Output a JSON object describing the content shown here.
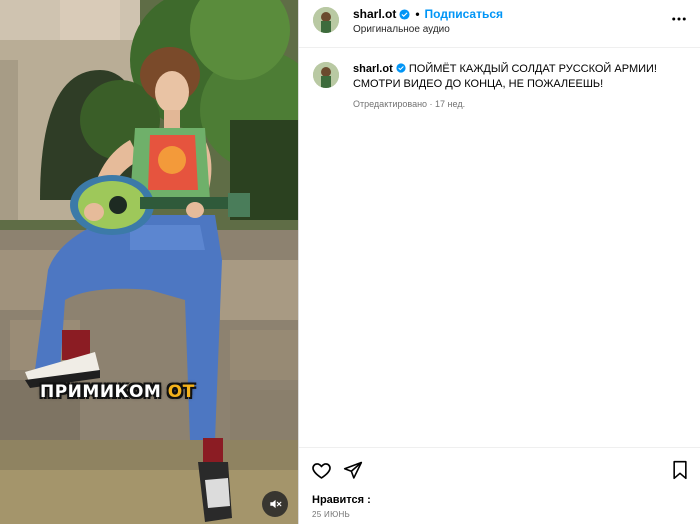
{
  "media": {
    "overlay_text_main": "ПРИМИКОМ",
    "overlay_text_accent": "ОТ",
    "mute_icon": "speaker-muted-icon"
  },
  "post": {
    "username": "sharl.ot",
    "follow_label": "Подписаться",
    "dot": "•",
    "audio_label": "Оригинальное аудио",
    "more_icon": "more-horizontal-icon"
  },
  "caption": {
    "username": "sharl.ot",
    "text": "ПОЙМЁТ КАЖДЫЙ СОЛДАТ РУССКОЙ АРМИИ! СМОТРИ ВИДЕО ДО КОНЦА, НЕ ПОЖАЛЕЕШЬ!",
    "meta": "Отредактировано · 17 нед."
  },
  "actions": {
    "like_icon": "heart-icon",
    "share_icon": "send-icon",
    "save_icon": "bookmark-icon",
    "likes_label": "Нравится :",
    "date": "25 ИЮНЬ"
  },
  "colors": {
    "link_blue": "#0095f6",
    "verified_blue": "#0095f6",
    "muted_text": "#737373",
    "border": "#dbdbdb"
  }
}
